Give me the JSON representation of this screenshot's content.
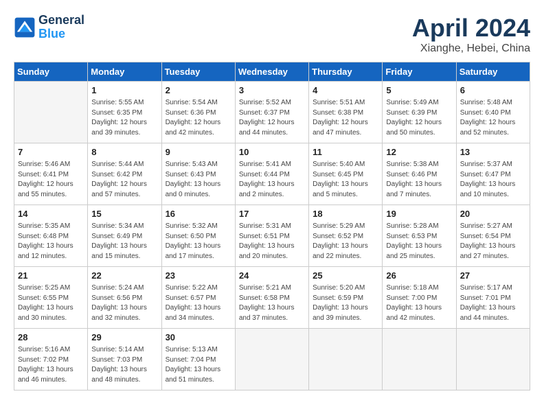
{
  "header": {
    "logo_line1": "General",
    "logo_line2": "Blue",
    "title": "April 2024",
    "subtitle": "Xianghe, Hebei, China"
  },
  "weekdays": [
    "Sunday",
    "Monday",
    "Tuesday",
    "Wednesday",
    "Thursday",
    "Friday",
    "Saturday"
  ],
  "weeks": [
    [
      {
        "day": "",
        "sunrise": "",
        "sunset": "",
        "daylight": "",
        "empty": true
      },
      {
        "day": "1",
        "sunrise": "5:55 AM",
        "sunset": "6:35 PM",
        "daylight": "12 hours and 39 minutes."
      },
      {
        "day": "2",
        "sunrise": "5:54 AM",
        "sunset": "6:36 PM",
        "daylight": "12 hours and 42 minutes."
      },
      {
        "day": "3",
        "sunrise": "5:52 AM",
        "sunset": "6:37 PM",
        "daylight": "12 hours and 44 minutes."
      },
      {
        "day": "4",
        "sunrise": "5:51 AM",
        "sunset": "6:38 PM",
        "daylight": "12 hours and 47 minutes."
      },
      {
        "day": "5",
        "sunrise": "5:49 AM",
        "sunset": "6:39 PM",
        "daylight": "12 hours and 50 minutes."
      },
      {
        "day": "6",
        "sunrise": "5:48 AM",
        "sunset": "6:40 PM",
        "daylight": "12 hours and 52 minutes."
      }
    ],
    [
      {
        "day": "7",
        "sunrise": "5:46 AM",
        "sunset": "6:41 PM",
        "daylight": "12 hours and 55 minutes."
      },
      {
        "day": "8",
        "sunrise": "5:44 AM",
        "sunset": "6:42 PM",
        "daylight": "12 hours and 57 minutes."
      },
      {
        "day": "9",
        "sunrise": "5:43 AM",
        "sunset": "6:43 PM",
        "daylight": "13 hours and 0 minutes."
      },
      {
        "day": "10",
        "sunrise": "5:41 AM",
        "sunset": "6:44 PM",
        "daylight": "13 hours and 2 minutes."
      },
      {
        "day": "11",
        "sunrise": "5:40 AM",
        "sunset": "6:45 PM",
        "daylight": "13 hours and 5 minutes."
      },
      {
        "day": "12",
        "sunrise": "5:38 AM",
        "sunset": "6:46 PM",
        "daylight": "13 hours and 7 minutes."
      },
      {
        "day": "13",
        "sunrise": "5:37 AM",
        "sunset": "6:47 PM",
        "daylight": "13 hours and 10 minutes."
      }
    ],
    [
      {
        "day": "14",
        "sunrise": "5:35 AM",
        "sunset": "6:48 PM",
        "daylight": "13 hours and 12 minutes."
      },
      {
        "day": "15",
        "sunrise": "5:34 AM",
        "sunset": "6:49 PM",
        "daylight": "13 hours and 15 minutes."
      },
      {
        "day": "16",
        "sunrise": "5:32 AM",
        "sunset": "6:50 PM",
        "daylight": "13 hours and 17 minutes."
      },
      {
        "day": "17",
        "sunrise": "5:31 AM",
        "sunset": "6:51 PM",
        "daylight": "13 hours and 20 minutes."
      },
      {
        "day": "18",
        "sunrise": "5:29 AM",
        "sunset": "6:52 PM",
        "daylight": "13 hours and 22 minutes."
      },
      {
        "day": "19",
        "sunrise": "5:28 AM",
        "sunset": "6:53 PM",
        "daylight": "13 hours and 25 minutes."
      },
      {
        "day": "20",
        "sunrise": "5:27 AM",
        "sunset": "6:54 PM",
        "daylight": "13 hours and 27 minutes."
      }
    ],
    [
      {
        "day": "21",
        "sunrise": "5:25 AM",
        "sunset": "6:55 PM",
        "daylight": "13 hours and 30 minutes."
      },
      {
        "day": "22",
        "sunrise": "5:24 AM",
        "sunset": "6:56 PM",
        "daylight": "13 hours and 32 minutes."
      },
      {
        "day": "23",
        "sunrise": "5:22 AM",
        "sunset": "6:57 PM",
        "daylight": "13 hours and 34 minutes."
      },
      {
        "day": "24",
        "sunrise": "5:21 AM",
        "sunset": "6:58 PM",
        "daylight": "13 hours and 37 minutes."
      },
      {
        "day": "25",
        "sunrise": "5:20 AM",
        "sunset": "6:59 PM",
        "daylight": "13 hours and 39 minutes."
      },
      {
        "day": "26",
        "sunrise": "5:18 AM",
        "sunset": "7:00 PM",
        "daylight": "13 hours and 42 minutes."
      },
      {
        "day": "27",
        "sunrise": "5:17 AM",
        "sunset": "7:01 PM",
        "daylight": "13 hours and 44 minutes."
      }
    ],
    [
      {
        "day": "28",
        "sunrise": "5:16 AM",
        "sunset": "7:02 PM",
        "daylight": "13 hours and 46 minutes."
      },
      {
        "day": "29",
        "sunrise": "5:14 AM",
        "sunset": "7:03 PM",
        "daylight": "13 hours and 48 minutes."
      },
      {
        "day": "30",
        "sunrise": "5:13 AM",
        "sunset": "7:04 PM",
        "daylight": "13 hours and 51 minutes."
      },
      {
        "day": "",
        "sunrise": "",
        "sunset": "",
        "daylight": "",
        "empty": true
      },
      {
        "day": "",
        "sunrise": "",
        "sunset": "",
        "daylight": "",
        "empty": true
      },
      {
        "day": "",
        "sunrise": "",
        "sunset": "",
        "daylight": "",
        "empty": true
      },
      {
        "day": "",
        "sunrise": "",
        "sunset": "",
        "daylight": "",
        "empty": true
      }
    ]
  ],
  "labels": {
    "sunrise": "Sunrise:",
    "sunset": "Sunset:",
    "daylight": "Daylight:"
  }
}
